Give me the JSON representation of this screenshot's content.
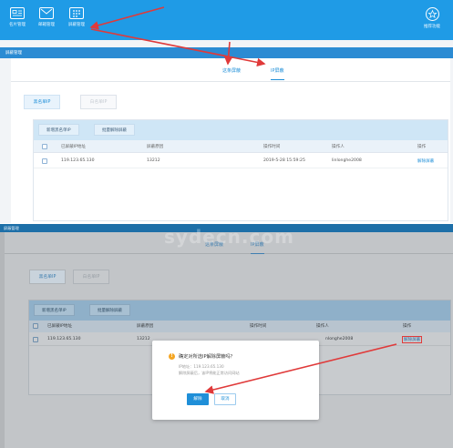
{
  "top_nav": [
    {
      "label": "名片管理",
      "icon": "id-card-icon"
    },
    {
      "label": "邮箱管理",
      "icon": "mail-icon"
    },
    {
      "label": "屏蔽管理",
      "icon": "grid-icon"
    }
  ],
  "top_nav_right": {
    "label": "推荐功能",
    "icon": "star-icon"
  },
  "panel1": {
    "section_title": "屏蔽管理",
    "tabs": [
      "这条屏蔽",
      "IP屏蔽"
    ],
    "subtabs": [
      "黑名单IP",
      "白名单IP"
    ],
    "toolbar": [
      "新增黑名单IP",
      "批量解除屏蔽"
    ],
    "columns": [
      "已屏蔽IP地址",
      "屏蔽原因",
      "操作时间",
      "操作人",
      "操作"
    ],
    "rows": [
      {
        "ip": "119.123.65.130",
        "reason": "13212",
        "time": "2019-5-28 15:59:25",
        "operator": "linlonghe2008",
        "action": "解除屏蔽"
      }
    ]
  },
  "panel2": {
    "section_title": "屏蔽管理",
    "tabs": [
      "这条屏蔽",
      "IP屏蔽"
    ],
    "subtabs": [
      "黑名单IP",
      "白名单IP"
    ],
    "toolbar": [
      "新增黑名单IP",
      "批量解除屏蔽"
    ],
    "columns": [
      "已屏蔽IP地址",
      "屏蔽原因",
      "操作时间",
      "操作人",
      "操作"
    ],
    "rows": [
      {
        "ip": "119.123.65.130",
        "reason": "13212",
        "operator": "nlonghe2008",
        "action": "解除屏蔽"
      }
    ],
    "watermark": "sydecn.com"
  },
  "dialog": {
    "title": "确定对所选IP解除屏蔽吗？",
    "line1": "IP地址：119.123.65.130",
    "line2": "解除屏蔽后，该IP将能正常访问网站",
    "ok": "解除",
    "cancel": "取消"
  },
  "colors": {
    "brand_blue": "#1f9be6",
    "annotation_red": "#e03a3a"
  }
}
